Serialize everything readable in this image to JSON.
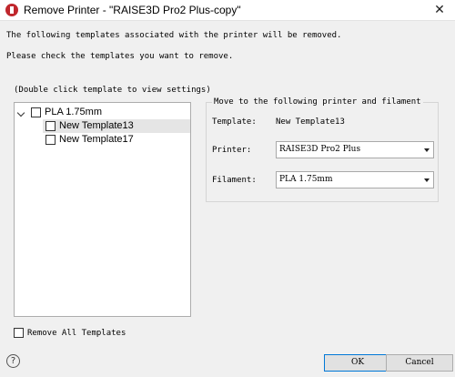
{
  "window": {
    "title": "Remove Printer - \"RAISE3D Pro2 Plus-copy\"",
    "close_glyph": "✕"
  },
  "messages": {
    "line1": "The following templates associated with the printer will be removed.",
    "line2": "Please check the templates you want to remove."
  },
  "tree": {
    "hint": "(Double click template to view settings)",
    "root": {
      "label": "PLA 1.75mm",
      "checked": false,
      "expanded": true
    },
    "children": [
      {
        "label": "New Template13",
        "checked": false,
        "selected": true
      },
      {
        "label": "New Template17",
        "checked": false,
        "selected": false
      }
    ]
  },
  "move_group": {
    "title": "Move to the following printer and filament",
    "template_label": "Template:",
    "template_value": "New Template13",
    "printer_label": "Printer:",
    "printer_value": "RAISE3D Pro2 Plus",
    "filament_label": "Filament:",
    "filament_value": "PLA 1.75mm"
  },
  "remove_all": {
    "label": "Remove All Templates",
    "checked": false
  },
  "buttons": {
    "ok": "OK",
    "cancel": "Cancel",
    "help": "?"
  },
  "colors": {
    "app_icon": "#c0272d",
    "ok_border": "#0078d7",
    "selection": "#e5e5e5"
  }
}
